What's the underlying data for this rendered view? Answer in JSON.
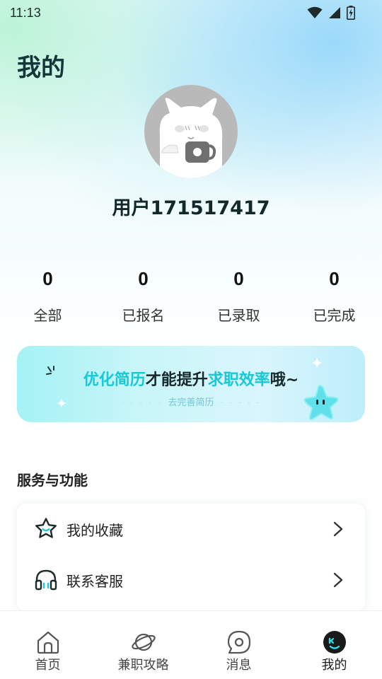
{
  "status_bar": {
    "time": "11:13"
  },
  "page": {
    "title": "我的"
  },
  "profile": {
    "username": "用户171517417"
  },
  "stats": [
    {
      "value": "0",
      "label": "全部"
    },
    {
      "value": "0",
      "label": "已报名"
    },
    {
      "value": "0",
      "label": "已录取"
    },
    {
      "value": "0",
      "label": "已完成"
    }
  ],
  "banner": {
    "part1": "优化简历",
    "part2": "才能提升",
    "part3": "求职效率",
    "part4": "哦~",
    "subtitle": "去完善简历"
  },
  "services": {
    "title": "服务与功能",
    "items": [
      {
        "label": "我的收藏",
        "icon": "star-icon"
      },
      {
        "label": "联系客服",
        "icon": "headset-icon"
      }
    ]
  },
  "tabbar": {
    "items": [
      {
        "label": "首页",
        "icon": "home-icon"
      },
      {
        "label": "兼职攻略",
        "icon": "planet-icon"
      },
      {
        "label": "消息",
        "icon": "message-icon"
      },
      {
        "label": "我的",
        "icon": "profile-icon"
      }
    ],
    "active_index": 3
  },
  "colors": {
    "accent": "#17c9d6",
    "title": "#153638",
    "banner_start": "#a5f2f5",
    "banner_end": "#bdeefa"
  }
}
